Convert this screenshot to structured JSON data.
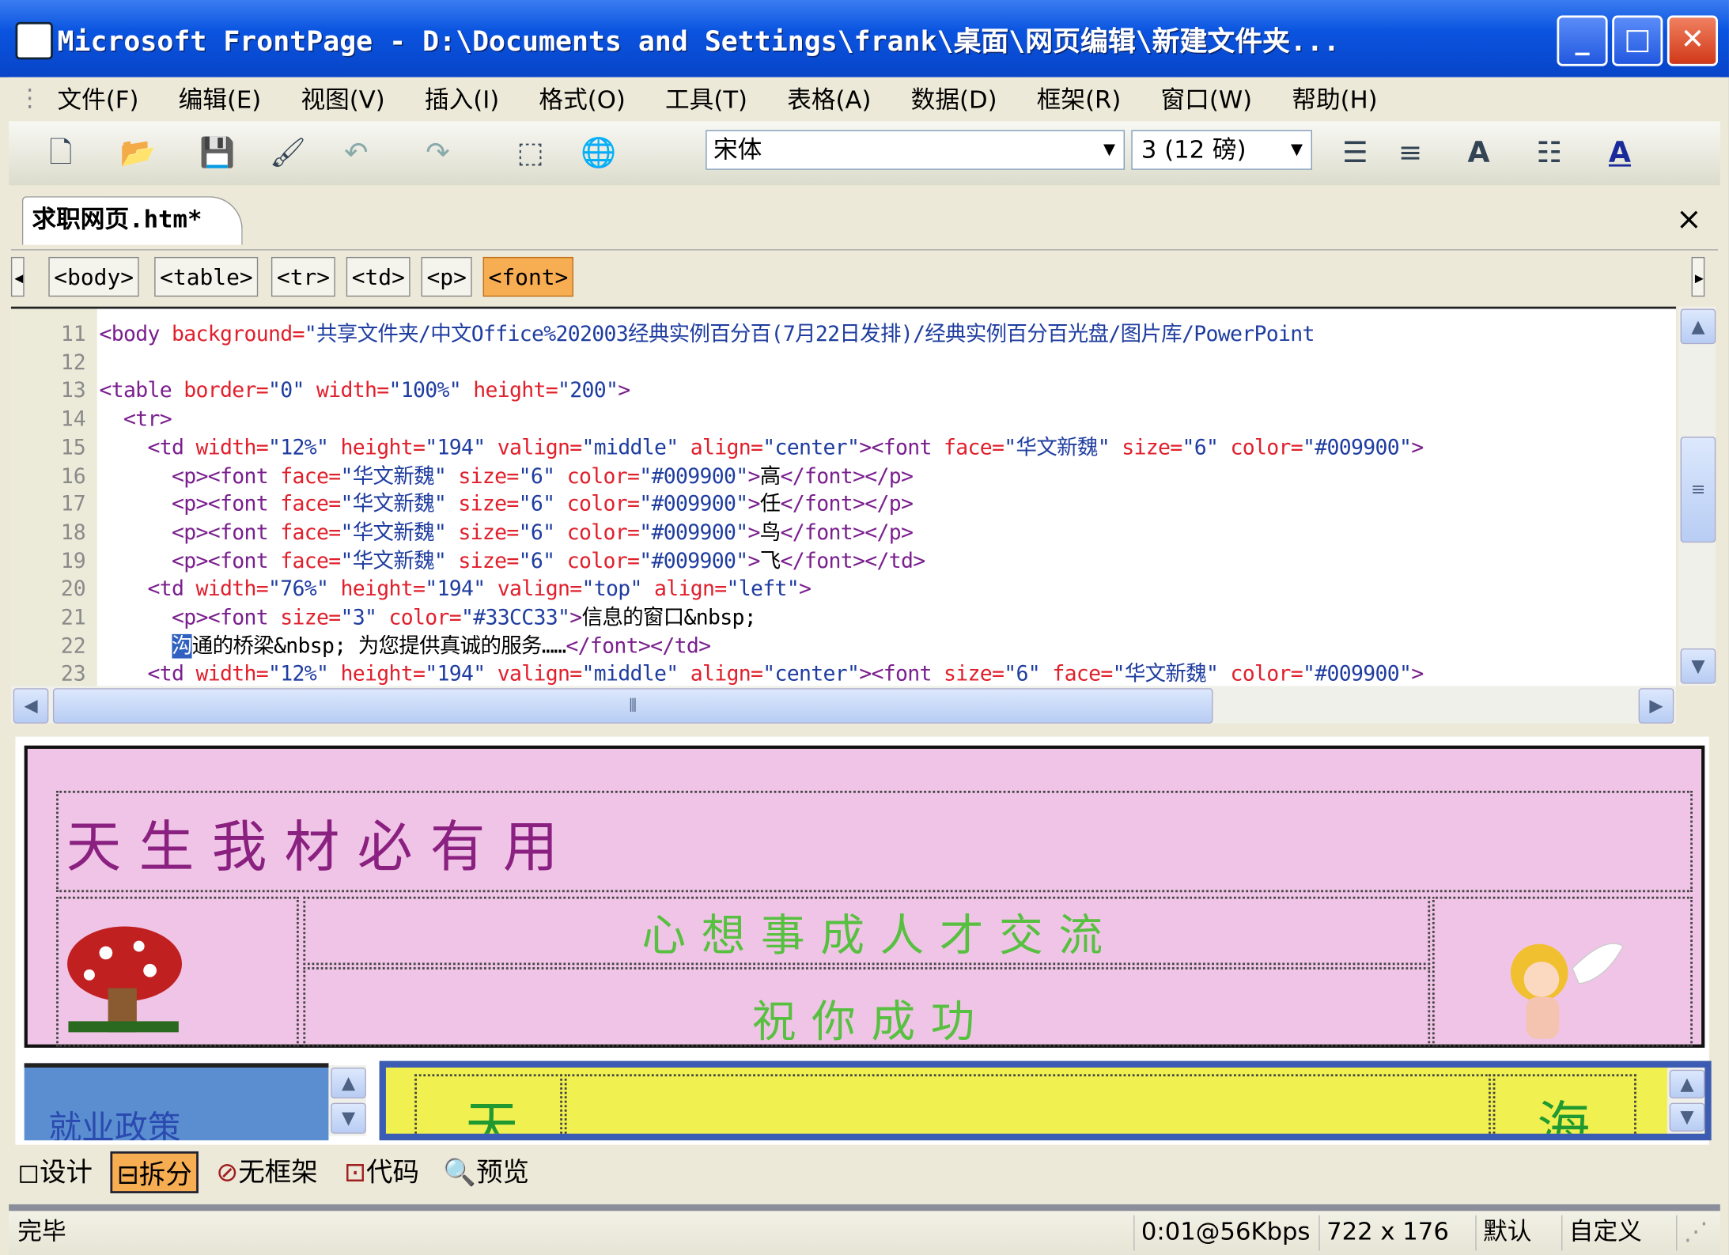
{
  "window": {
    "title": "Microsoft FrontPage - D:\\Documents and Settings\\frank\\桌面\\网页编辑\\新建文件夹...",
    "minimize": "_",
    "maximize": "□",
    "close": "✕"
  },
  "menu": [
    "文件(F)",
    "编辑(E)",
    "视图(V)",
    "插入(I)",
    "格式(O)",
    "工具(T)",
    "表格(A)",
    "数据(D)",
    "框架(R)",
    "窗口(W)",
    "帮助(H)"
  ],
  "toolbar": {
    "font": "宋体",
    "size": "3 (12 磅)",
    "icons": [
      "new-icon",
      "open-icon",
      "save-icon",
      "format-painter-icon",
      "undo-icon",
      "redo-icon",
      "frame-icon",
      "web-icon",
      "align-center-icon",
      "justify-icon",
      "grow-font-icon",
      "list-icon",
      "font-color-icon"
    ]
  },
  "document_tab": {
    "label": "求职网页.htm*",
    "close": "×"
  },
  "tag_selector": [
    "<body>",
    "<table>",
    "<tr>",
    "<td>",
    "<p>",
    "<font>"
  ],
  "code": {
    "lines": [
      {
        "n": "11",
        "segs": [
          [
            "tg",
            "<body "
          ],
          [
            "at",
            "background="
          ],
          [
            "vl",
            "\"共享文件夹/中文Office%202003经典实例百分百(7月22日发排)/经典实例百分百光盘/图片库/PowerPoint"
          ]
        ]
      },
      {
        "n": "12",
        "segs": []
      },
      {
        "n": "13",
        "segs": [
          [
            "tg",
            "<table "
          ],
          [
            "at",
            "border="
          ],
          [
            "vl",
            "\"0\" "
          ],
          [
            "at",
            "width="
          ],
          [
            "vl",
            "\"100%\" "
          ],
          [
            "at",
            "height="
          ],
          [
            "vl",
            "\"200\""
          ],
          [
            "tg",
            ">"
          ]
        ]
      },
      {
        "n": "14",
        "segs": [
          [
            "tg",
            "  <tr>"
          ]
        ]
      },
      {
        "n": "15",
        "segs": [
          [
            "tg",
            "    <td "
          ],
          [
            "at",
            "width="
          ],
          [
            "vl",
            "\"12%\" "
          ],
          [
            "at",
            "height="
          ],
          [
            "vl",
            "\"194\" "
          ],
          [
            "at",
            "valign="
          ],
          [
            "vl",
            "\"middle\" "
          ],
          [
            "at",
            "align="
          ],
          [
            "vl",
            "\"center\""
          ],
          [
            "tg",
            "><font "
          ],
          [
            "at",
            "face="
          ],
          [
            "vl",
            "\"华文新魏\" "
          ],
          [
            "at",
            "size="
          ],
          [
            "vl",
            "\"6\" "
          ],
          [
            "at",
            "color="
          ],
          [
            "vl",
            "\"#009900\""
          ],
          [
            "tg",
            ">"
          ]
        ]
      },
      {
        "n": "16",
        "segs": [
          [
            "tg",
            "      <p><font "
          ],
          [
            "at",
            "face="
          ],
          [
            "vl",
            "\"华文新魏\" "
          ],
          [
            "at",
            "size="
          ],
          [
            "vl",
            "\"6\" "
          ],
          [
            "at",
            "color="
          ],
          [
            "vl",
            "\"#009900\""
          ],
          [
            "tg",
            ">"
          ],
          [
            "tx",
            "高"
          ],
          [
            "tg",
            "</font></p>"
          ]
        ]
      },
      {
        "n": "17",
        "segs": [
          [
            "tg",
            "      <p><font "
          ],
          [
            "at",
            "face="
          ],
          [
            "vl",
            "\"华文新魏\" "
          ],
          [
            "at",
            "size="
          ],
          [
            "vl",
            "\"6\" "
          ],
          [
            "at",
            "color="
          ],
          [
            "vl",
            "\"#009900\""
          ],
          [
            "tg",
            ">"
          ],
          [
            "tx",
            "任"
          ],
          [
            "tg",
            "</font></p>"
          ]
        ]
      },
      {
        "n": "18",
        "segs": [
          [
            "tg",
            "      <p><font "
          ],
          [
            "at",
            "face="
          ],
          [
            "vl",
            "\"华文新魏\" "
          ],
          [
            "at",
            "size="
          ],
          [
            "vl",
            "\"6\" "
          ],
          [
            "at",
            "color="
          ],
          [
            "vl",
            "\"#009900\""
          ],
          [
            "tg",
            ">"
          ],
          [
            "tx",
            "鸟"
          ],
          [
            "tg",
            "</font></p>"
          ]
        ]
      },
      {
        "n": "19",
        "segs": [
          [
            "tg",
            "      <p><font "
          ],
          [
            "at",
            "face="
          ],
          [
            "vl",
            "\"华文新魏\" "
          ],
          [
            "at",
            "size="
          ],
          [
            "vl",
            "\"6\" "
          ],
          [
            "at",
            "color="
          ],
          [
            "vl",
            "\"#009900\""
          ],
          [
            "tg",
            ">"
          ],
          [
            "tx",
            "飞"
          ],
          [
            "tg",
            "</font></td>"
          ]
        ]
      },
      {
        "n": "20",
        "segs": [
          [
            "tg",
            "    <td "
          ],
          [
            "at",
            "width="
          ],
          [
            "vl",
            "\"76%\" "
          ],
          [
            "at",
            "height="
          ],
          [
            "vl",
            "\"194\" "
          ],
          [
            "at",
            "valign="
          ],
          [
            "vl",
            "\"top\" "
          ],
          [
            "at",
            "align="
          ],
          [
            "vl",
            "\"left\""
          ],
          [
            "tg",
            ">"
          ]
        ]
      },
      {
        "n": "21",
        "segs": [
          [
            "tg",
            "      <p><font "
          ],
          [
            "at",
            "size="
          ],
          [
            "vl",
            "\"3\" "
          ],
          [
            "at",
            "color="
          ],
          [
            "vl",
            "\"#33CC33\""
          ],
          [
            "tg",
            ">"
          ],
          [
            "tx",
            "信息的窗口&nbsp;"
          ]
        ]
      },
      {
        "n": "22",
        "segs": [
          [
            "tx",
            "      "
          ],
          [
            "sel",
            "沟"
          ],
          [
            "tx",
            "通的桥梁&nbsp; 为您提供真诚的服务……"
          ],
          [
            "tg",
            "</font></td>"
          ]
        ]
      },
      {
        "n": "23",
        "segs": [
          [
            "tg",
            "    <td "
          ],
          [
            "at",
            "width="
          ],
          [
            "vl",
            "\"12%\" "
          ],
          [
            "at",
            "height="
          ],
          [
            "vl",
            "\"194\" "
          ],
          [
            "at",
            "valign="
          ],
          [
            "vl",
            "\"middle\" "
          ],
          [
            "at",
            "align="
          ],
          [
            "vl",
            "\"center\""
          ],
          [
            "tg",
            "><font "
          ],
          [
            "at",
            "size="
          ],
          [
            "vl",
            "\"6\" "
          ],
          [
            "at",
            "face="
          ],
          [
            "vl",
            "\"华文新魏\" "
          ],
          [
            "at",
            "color="
          ],
          [
            "vl",
            "\"#009900\""
          ],
          [
            "tg",
            ">"
          ]
        ]
      }
    ]
  },
  "design": {
    "heading": "天生我材必有用",
    "banner": "心想事成人才交流",
    "subtitle": "祝你成功",
    "left_frame": "就业政策",
    "yellow_left": "天",
    "yellow_right": "海",
    "colors": {
      "pink": "#f0c4e6",
      "heading": "#8a2080",
      "green": "#58c040",
      "blue_frame": "#5a8ed0",
      "yellow_frame": "#f0f050"
    }
  },
  "view_tabs": [
    {
      "label": "设计",
      "icon": "design-icon"
    },
    {
      "label": "拆分",
      "icon": "split-icon",
      "active": true
    },
    {
      "label": "无框架",
      "icon": "no-frames-icon"
    },
    {
      "label": "代码",
      "icon": "code-icon"
    },
    {
      "label": "预览",
      "icon": "preview-icon"
    }
  ],
  "status": {
    "text": "完毕",
    "speed": "0:01@56Kbps",
    "dimensions": "722 x 176",
    "mode": "默认",
    "custom": "自定义"
  }
}
